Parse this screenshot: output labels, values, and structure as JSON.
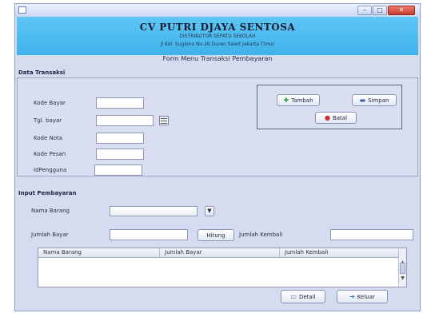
{
  "window": {
    "controls": {
      "minimize": "–",
      "maximize": "□",
      "close": "✕"
    }
  },
  "header": {
    "company": "CV PUTRI DJAYA SENTOSA",
    "tagline": "DISTRIBUTOR SEPATU SEKOLAH",
    "address": "Jl Kol. Sugiono No.26 Duren Sawit Jakarta Timur"
  },
  "form_title": "Form Menu Transaksi Pembayaran",
  "data_transaksi": {
    "section_label": "Data Transaksi",
    "fields": {
      "kode_bayar": {
        "label": "Kode Bayar",
        "value": ""
      },
      "tgl_bayar": {
        "label": "Tgl. bayar",
        "value": ""
      },
      "kode_nota": {
        "label": "Kode Nota",
        "value": ""
      },
      "kode_pesan": {
        "label": "Kode Pesan",
        "value": ""
      },
      "id_pengguna": {
        "label": "IdPengguna",
        "value": ""
      }
    },
    "buttons": {
      "tambah": "Tambah",
      "simpan": "Simpan",
      "batal": "Batal"
    }
  },
  "input_pembayaran": {
    "section_label": "Input Pembayaran",
    "nama_barang": {
      "label": "Nama Barang",
      "selected": ""
    },
    "jumlah_bayar": {
      "label": "Jumlah Bayar",
      "value": ""
    },
    "hitung_button": "Hitung",
    "jumlah_kembali": {
      "label": "Jumlah Kembali",
      "value": ""
    },
    "table": {
      "columns": [
        "Nama Barang",
        "Jumlah Bayar",
        "Jumlah Kembali"
      ],
      "rows": []
    }
  },
  "footer_buttons": {
    "detail": "Detail",
    "keluar": "Keluar"
  },
  "icons": {
    "tambah": "plus-icon",
    "simpan": "save-icon",
    "batal": "cancel-icon",
    "calendar": "calendar-icon",
    "detail": "detail-icon",
    "keluar": "exit-arrow-icon"
  },
  "colors": {
    "header_bg": "#3eb2ea",
    "window_bg": "#d6dcf0",
    "close_button": "#c83b2c"
  }
}
